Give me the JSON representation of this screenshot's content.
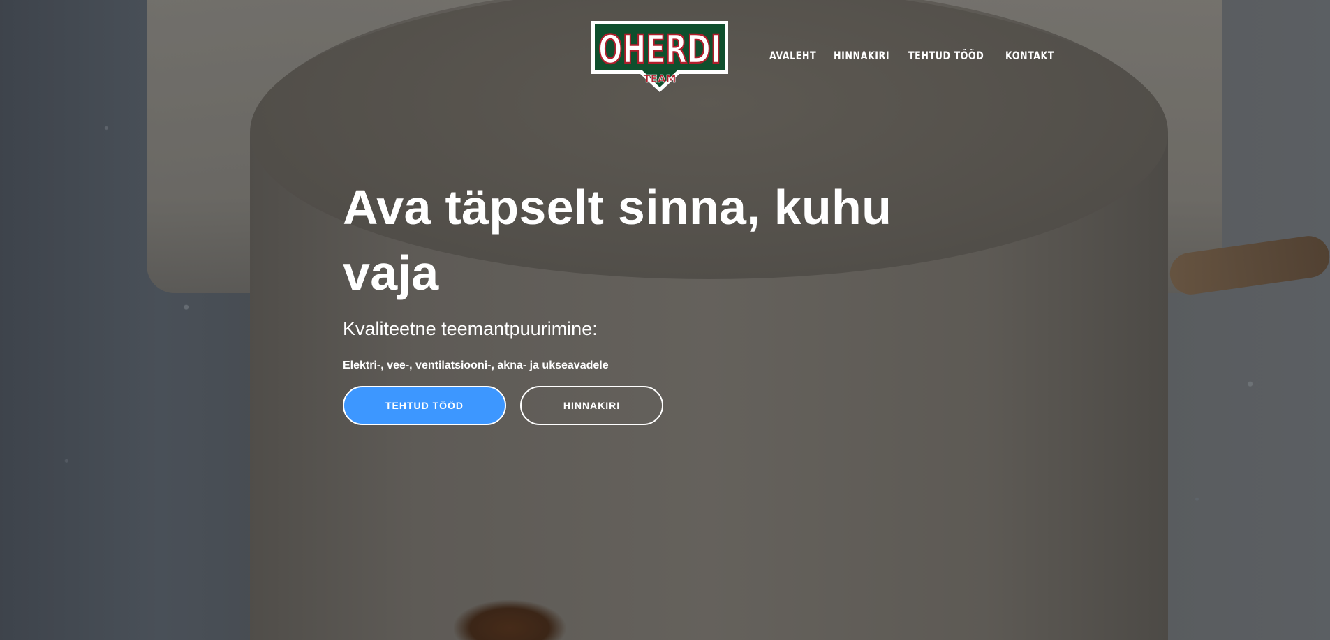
{
  "brand": {
    "logo_text": "OHERDI",
    "logo_subtext": "TEAM",
    "colors": {
      "logo_green": "#0f4f2d",
      "logo_red": "#b11e2c",
      "accent_blue": "#3d97ff"
    }
  },
  "nav": {
    "items": [
      {
        "label": "AVALEHT"
      },
      {
        "label": "HINNAKIRI"
      },
      {
        "label": "TEHTUD TÖÖD"
      },
      {
        "label": "KONTAKT"
      }
    ]
  },
  "hero": {
    "title": "Ava täpselt sinna, kuhu vaja",
    "subtitle": "Kvaliteetne teemantpuurimine:",
    "description": "Elektri-, vee-, ventilatsiooni-, akna- ja ukseavadele",
    "primary_button": "TEHTUD TÖÖD",
    "secondary_button": "HINNAKIRI"
  }
}
